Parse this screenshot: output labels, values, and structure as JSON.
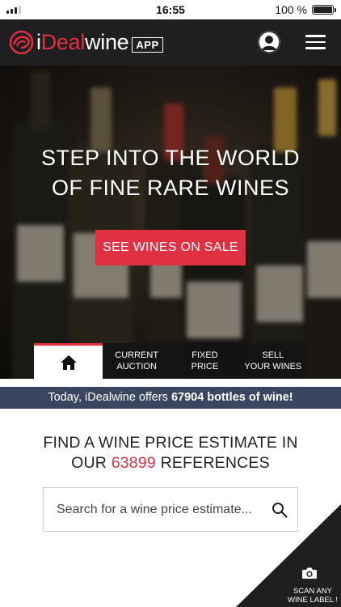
{
  "status_bar": {
    "time": "16:55",
    "battery": "100 %"
  },
  "header": {
    "brand_prefix": "i",
    "brand_accent": "Deal",
    "brand_suffix": "wine",
    "app_badge": "APP"
  },
  "hero": {
    "title_line1": "STEP INTO THE WORLD",
    "title_line2": "OF FINE RARE WINES",
    "cta": "SEE WINES ON SALE"
  },
  "tabs": [
    {
      "line1": "CURRENT",
      "line2": "AUCTION"
    },
    {
      "line1": "FIXED",
      "line2": "PRICE"
    },
    {
      "line1": "SELL",
      "line2": "YOUR WINES"
    }
  ],
  "offers": {
    "prefix": "Today, iDealwine offers ",
    "count": "67904 bottles of wine!"
  },
  "estimate": {
    "line1": "FIND A WINE PRICE ESTIMATE IN",
    "line2_prefix": "OUR ",
    "count": "63899",
    "line2_suffix": " REFERENCES"
  },
  "search": {
    "placeholder": "Search for a wine price estimate..."
  },
  "scan": {
    "line1": "SCAN ANY",
    "line2": "WINE LABEL !"
  },
  "colors": {
    "accent": "#e03041",
    "header_bg": "#1f1f22",
    "offers_bg": "#38475f"
  },
  "icons": [
    "signal-icon",
    "battery-icon",
    "logo-icon",
    "account-icon",
    "menu-icon",
    "home-icon",
    "search-icon",
    "camera-icon"
  ]
}
